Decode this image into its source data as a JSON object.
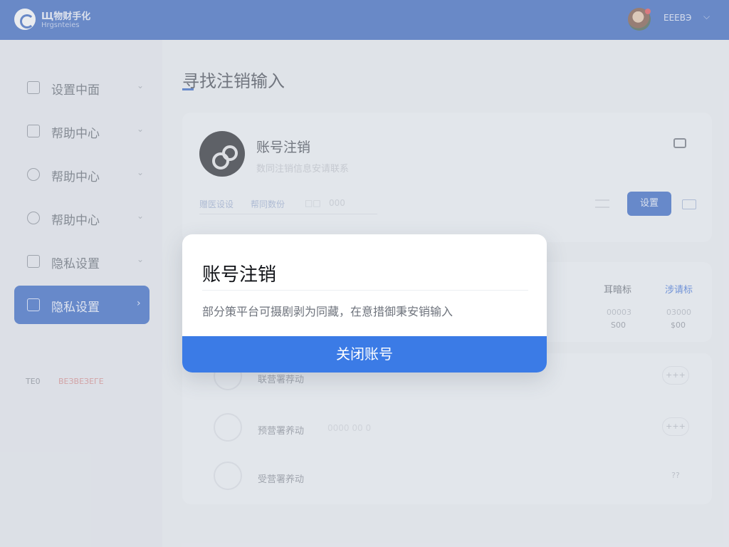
{
  "header": {
    "brand_name": "Щ物财手化",
    "brand_sub": "Hrgsnteies",
    "user_name": "ЕЕЕВЭ",
    "caret": "⌵",
    "accent": "#2f5fbf"
  },
  "sidebar": {
    "items": [
      {
        "label": "设置中面",
        "icon": "document-icon"
      },
      {
        "label": "帮助中心",
        "icon": "list-icon"
      },
      {
        "label": "帮助中心",
        "icon": "chart-icon"
      },
      {
        "label": "帮助中心",
        "icon": "target-icon"
      },
      {
        "label": "隐私设置",
        "icon": "window-icon"
      },
      {
        "label": "隐私设置",
        "icon": "lock-icon",
        "active": true
      }
    ],
    "footer_a": "TЕ0",
    "footer_b": "ВЕЗВЕЗЕГЕ"
  },
  "main": {
    "title": "寻找注销输入",
    "card1": {
      "title": "账号注销",
      "subtitle": "数同注销信息安请联系",
      "tabs": [
        "赠医设设",
        "帮同数份",
        "□□",
        "000"
      ],
      "button": "设置"
    },
    "card2": {
      "headers": [
        "耳暗标",
        "涉请标"
      ],
      "col1_values": [
        "00003",
        "S00"
      ],
      "col2_values": [
        "03000",
        "$00"
      ]
    },
    "rows": [
      {
        "label": "联营署荐动",
        "meta": "",
        "action": "+++"
      },
      {
        "label": "预营署养动",
        "meta": "0000 00 0",
        "action": "+++"
      },
      {
        "label": "受营署养动",
        "meta": "",
        "action": "??"
      }
    ]
  },
  "dialog": {
    "title": "账号注销",
    "body": "部分策平台可摄剧剥为同藏，在意措御秉安销输入",
    "button": "关闭账号",
    "button_color": "#3b7be6"
  }
}
